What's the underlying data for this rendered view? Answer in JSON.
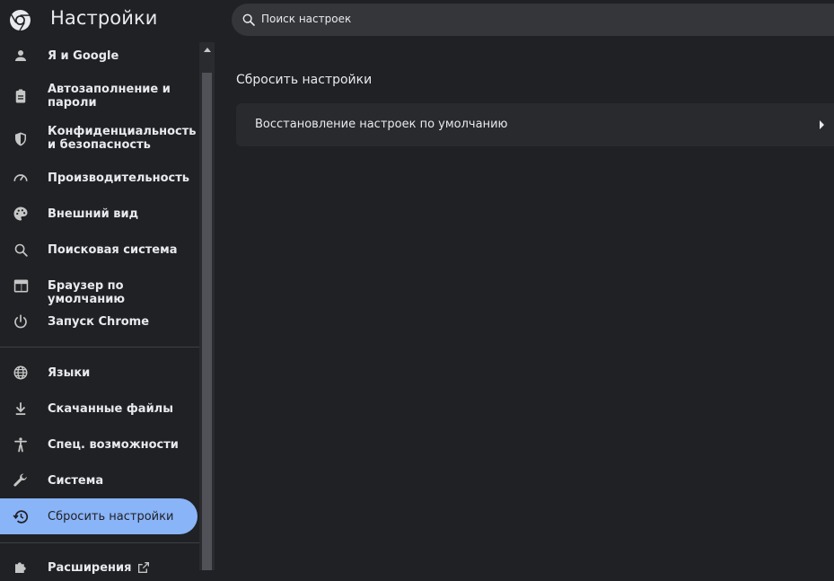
{
  "header": {
    "title": "Настройки",
    "logo_icon": "chrome-logo-icon"
  },
  "search": {
    "placeholder": "Поиск настроек",
    "value": "",
    "icon": "search-icon"
  },
  "sidebar": {
    "items": [
      {
        "label": "Я и Google",
        "icon": "person-icon"
      },
      {
        "label": "Автозаполнение и пароли",
        "icon": "clipboard-icon"
      },
      {
        "label": "Конфиденциальность и безопасность",
        "icon": "shield-icon"
      },
      {
        "label": "Производительность",
        "icon": "speedometer-icon"
      },
      {
        "label": "Внешний вид",
        "icon": "palette-icon"
      },
      {
        "label": "Поисковая система",
        "icon": "search-icon"
      },
      {
        "label": "Браузер по умолчанию",
        "icon": "browser-window-icon"
      },
      {
        "label": "Запуск Chrome",
        "icon": "power-icon"
      },
      {
        "label": "Языки",
        "icon": "globe-icon"
      },
      {
        "label": "Скачанные файлы",
        "icon": "download-icon"
      },
      {
        "label": "Спец. возможности",
        "icon": "accessibility-icon"
      },
      {
        "label": "Система",
        "icon": "wrench-icon"
      },
      {
        "label": "Сбросить настройки",
        "icon": "restore-history-icon",
        "selected": true
      },
      {
        "label": "Расширения",
        "icon": "puzzle-icon",
        "trailing_icon": "open-external-icon"
      }
    ]
  },
  "main": {
    "section_title": "Сбросить настройки",
    "rows": [
      {
        "label": "Восстановление настроек по умолчанию",
        "icon": "arrow-right-icon"
      }
    ]
  },
  "colors": {
    "background": "#202124",
    "card": "#292a2d",
    "selected": "#8ab4f8",
    "text": "#e8eaed",
    "search_bg": "#35363a"
  }
}
